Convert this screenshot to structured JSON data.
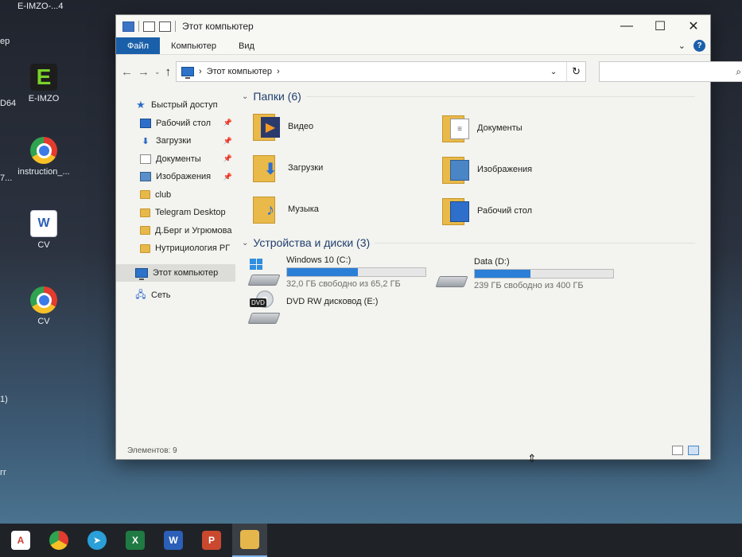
{
  "desktop": {
    "icons": [
      {
        "label": "E-IMZO",
        "icon": "e-imzo-icon"
      },
      {
        "label": "instruction_...",
        "icon": "chrome-icon"
      },
      {
        "label": "CV",
        "icon": "word-icon"
      },
      {
        "label": "CV",
        "icon": "chrome-icon"
      }
    ],
    "top_label": "E-IMZO-...4",
    "top_left_crop": "ер",
    "crop_labels": [
      "D64",
      "7...",
      "1)",
      "гг"
    ]
  },
  "window": {
    "title": "Этот компьютер",
    "buttons": {
      "minimize": "—",
      "maximize": "☐",
      "close": "✕"
    },
    "ribbon_tabs": [
      "Файл",
      "Компьютер",
      "Вид"
    ],
    "address": {
      "crumb": "Этот компьютер",
      "separator": "›",
      "dropdown": "⌄",
      "refresh": "↻"
    },
    "search_placeholder": "",
    "nav": {
      "quick_access": "Быстрый доступ",
      "pinned": [
        {
          "label": "Рабочий стол",
          "icon": "desktop-icon"
        },
        {
          "label": "Загрузки",
          "icon": "downloads-icon"
        },
        {
          "label": "Документы",
          "icon": "documents-icon"
        },
        {
          "label": "Изображения",
          "icon": "pictures-icon"
        }
      ],
      "folders": [
        "club",
        "Telegram Desktop",
        "Д.Берг и Угрюмова",
        "Нутрициология РГ"
      ],
      "this_pc": "Этот компьютер",
      "network": "Сеть"
    },
    "folders_group": "Папки (6)",
    "folders": [
      {
        "label": "Видео",
        "icon": "video-folder-icon"
      },
      {
        "label": "Документы",
        "icon": "documents-folder-icon"
      },
      {
        "label": "Загрузки",
        "icon": "downloads-folder-icon"
      },
      {
        "label": "Изображения",
        "icon": "pictures-folder-icon"
      },
      {
        "label": "Музыка",
        "icon": "music-folder-icon"
      },
      {
        "label": "Рабочий стол",
        "icon": "desktop-folder-icon"
      }
    ],
    "devices_group": "Устройства и диски (3)",
    "drives": [
      {
        "name": "Windows 10 (C:)",
        "free": "32,0 ГБ свободно из 65,2 ГБ",
        "used_fraction": 0.51
      },
      {
        "name": "Data (D:)",
        "free": "239 ГБ свободно из 400 ГБ",
        "used_fraction": 0.4
      }
    ],
    "dvd": {
      "name": "DVD RW дисковод (E:)",
      "badge": "DVD"
    },
    "status": "Элементов: 9"
  },
  "taskbar": {
    "items": [
      "acrobat-icon",
      "chrome-icon",
      "telegram-icon",
      "excel-icon",
      "word-icon",
      "powerpoint-icon",
      "explorer-icon"
    ],
    "labels": {
      "excel": "X",
      "word": "W",
      "powerpoint": "P"
    }
  },
  "colors": {
    "accent": "#1a5fa9",
    "drive_bar": "#2b7fd7",
    "folder": "#e9b949"
  }
}
